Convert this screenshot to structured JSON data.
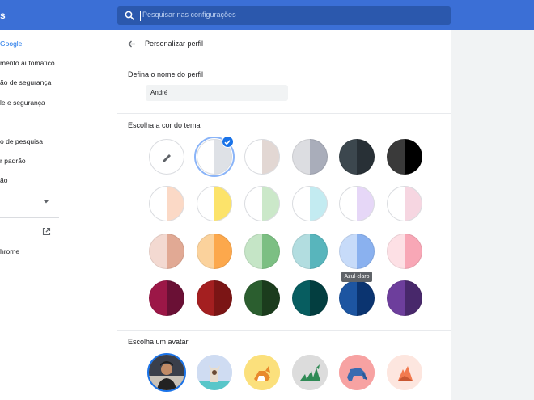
{
  "topbar": {
    "title_fragment": "s",
    "search_placeholder": "Pesquisar nas configurações"
  },
  "sidebar": {
    "items": [
      {
        "label": "Google",
        "active": true
      },
      {
        "label": "mento automático"
      },
      {
        "label": "ão de segurança"
      },
      {
        "label": "le e segurança"
      },
      {
        "label": "o de pesquisa"
      },
      {
        "label": "r padrão"
      },
      {
        "label": "ão"
      }
    ],
    "about_label": "hrome"
  },
  "page": {
    "title": "Personalizar perfil",
    "profile_name_label": "Defina o nome do perfil",
    "profile_name_value": "André",
    "theme_label": "Escolha a cor do tema",
    "avatar_label": "Escolha um avatar",
    "tooltip": "Azul-claro"
  },
  "themes": [
    {
      "name": "custom-color",
      "left": "#ffffff",
      "right": "#ffffff",
      "icon": "pencil-icon"
    },
    {
      "name": "default",
      "left": "#ffffff",
      "right": "#dee1e6",
      "selected": true
    },
    {
      "name": "warm-grey",
      "left": "#ffffff",
      "right": "#e2d7d3"
    },
    {
      "name": "grey",
      "left": "#dcdde1",
      "right": "#a9adba"
    },
    {
      "name": "dark-teal",
      "left": "#3c474e",
      "right": "#283036"
    },
    {
      "name": "black",
      "left": "#3a3a3a",
      "right": "#000000"
    },
    {
      "name": "beige-peach",
      "left": "#ffffff",
      "right": "#fbd9c6"
    },
    {
      "name": "yellow",
      "left": "#ffffff",
      "right": "#fce36a"
    },
    {
      "name": "green",
      "left": "#ffffff",
      "right": "#cbe8c9"
    },
    {
      "name": "light-teal",
      "left": "#ffffff",
      "right": "#c3ebf1"
    },
    {
      "name": "light-purple",
      "left": "#ffffff",
      "right": "#e6d7f7"
    },
    {
      "name": "pink",
      "left": "#ffffff",
      "right": "#f6d6e1"
    },
    {
      "name": "peach",
      "left": "#f3d9d1",
      "right": "#e1a994"
    },
    {
      "name": "orange",
      "left": "#fbd29c",
      "right": "#fca84c"
    },
    {
      "name": "mid-green",
      "left": "#c5e5c6",
      "right": "#7cbf83"
    },
    {
      "name": "cyan",
      "left": "#b2dde0",
      "right": "#58b5bc"
    },
    {
      "name": "light-blue",
      "left": "#c7dbf9",
      "right": "#8ab1ef"
    },
    {
      "name": "light-pink",
      "left": "#fde0e5",
      "right": "#f8a7b6"
    },
    {
      "name": "magenta",
      "left": "#9c1747",
      "right": "#6a1035"
    },
    {
      "name": "red",
      "left": "#a41f20",
      "right": "#7b1515"
    },
    {
      "name": "dark-green",
      "left": "#2b5e2f",
      "right": "#1b3c1d"
    },
    {
      "name": "dark-cyan",
      "left": "#075d60",
      "right": "#033e40"
    },
    {
      "name": "dark-blue",
      "left": "#1d55a1",
      "right": "#0b3470"
    },
    {
      "name": "violet",
      "left": "#6d3e9c",
      "right": "#48286b"
    }
  ],
  "avatars": [
    {
      "name": "user-photo",
      "bg": "#3a3f4a"
    },
    {
      "name": "cat",
      "bg": "#cfdcf2"
    },
    {
      "name": "fox",
      "bg": "#fbe07c"
    },
    {
      "name": "dragon",
      "bg": "#dcdcdc"
    },
    {
      "name": "elephant",
      "bg": "#f7a2a2"
    },
    {
      "name": "origami-fox",
      "bg": "#fde6df"
    }
  ]
}
